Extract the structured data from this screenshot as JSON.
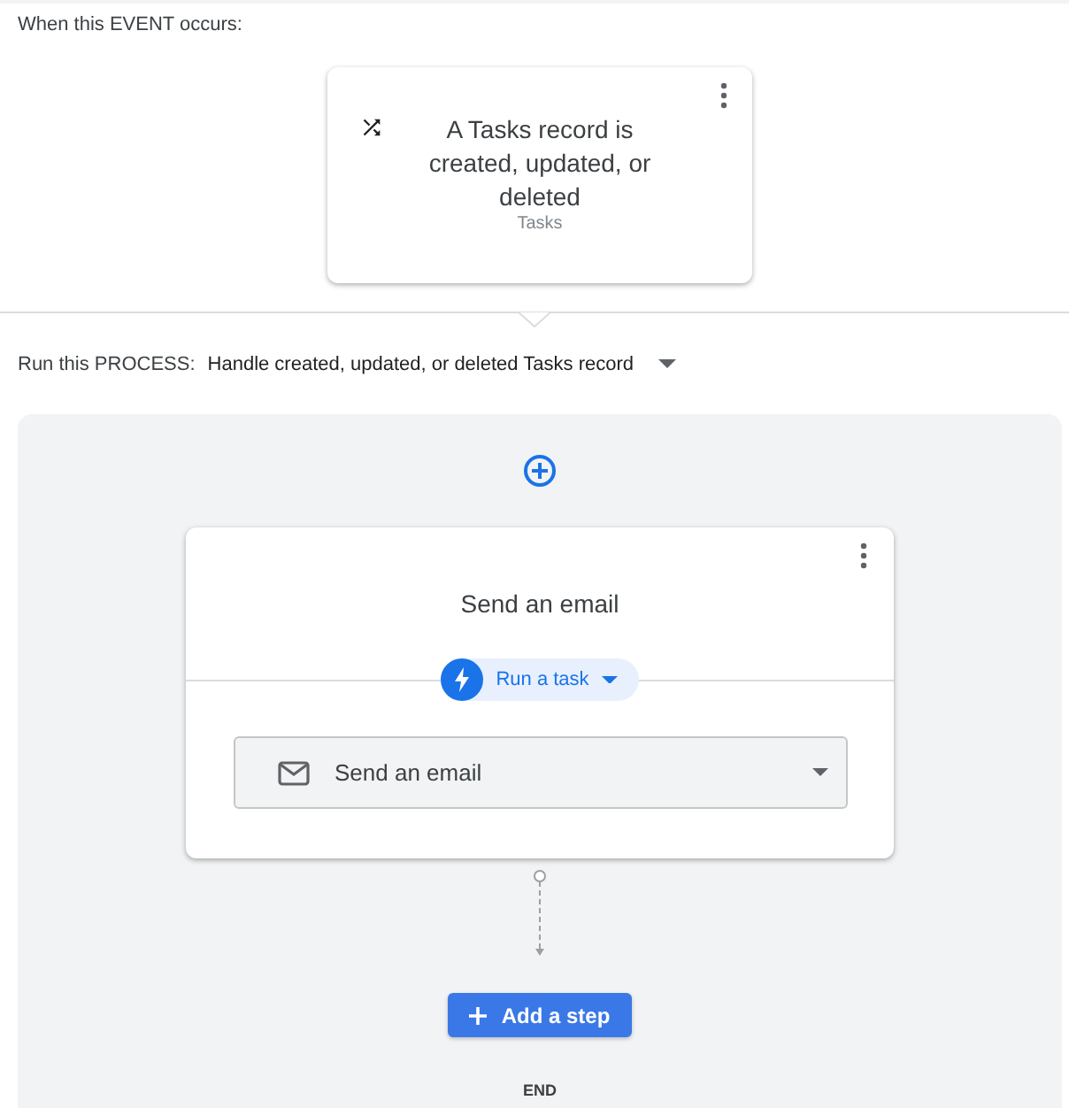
{
  "event": {
    "label": "When this EVENT occurs:",
    "card": {
      "title": "A Tasks record is created, updated, or deleted",
      "subtitle": "Tasks"
    }
  },
  "process": {
    "label": "Run this PROCESS:",
    "value": "Handle created, updated, or deleted Tasks record"
  },
  "steps": [
    {
      "kind": "task",
      "title": "Send an email",
      "type_label": "Run a task",
      "action": "Send an email"
    }
  ],
  "add_step_button": "Add a step",
  "end_label": "END"
}
